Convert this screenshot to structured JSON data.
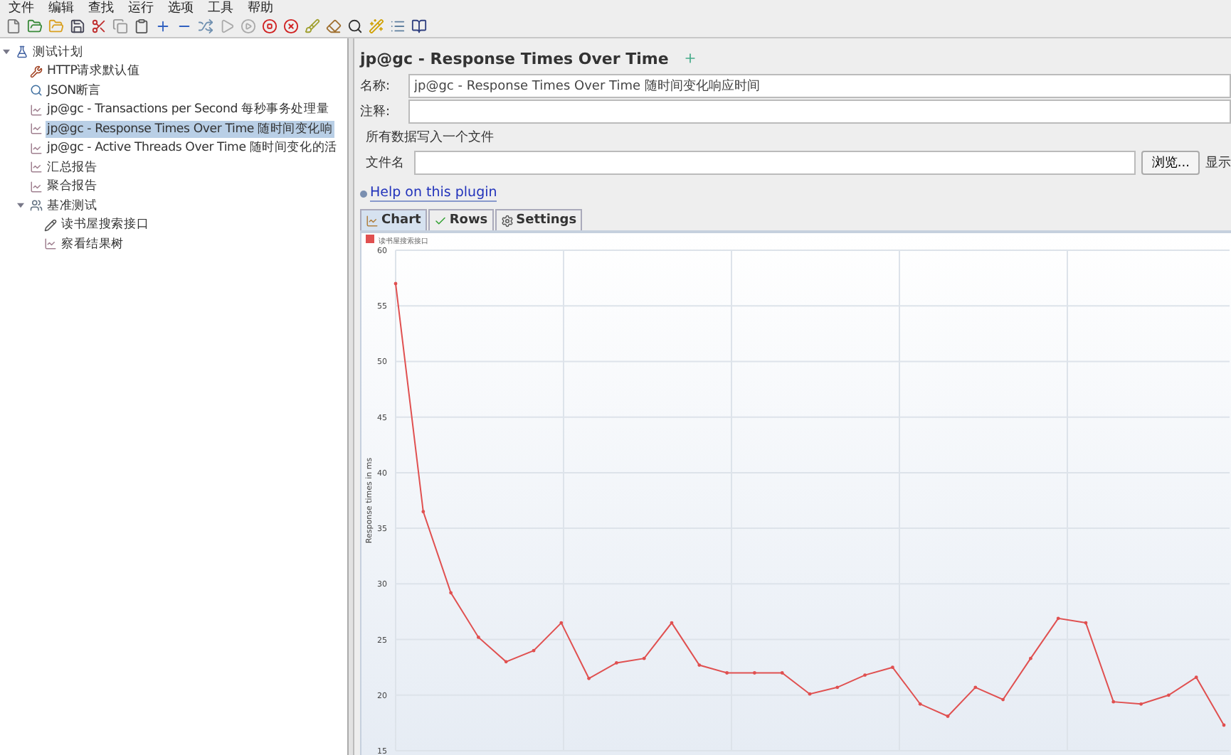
{
  "menu": [
    "文件",
    "编辑",
    "查找",
    "运行",
    "选项",
    "工具",
    "帮助"
  ],
  "tree": [
    {
      "label": "测试计划",
      "kind": "plan",
      "expanded": true,
      "selected": false,
      "children": [
        {
          "label": "HTTP请求默认值",
          "kind": "config",
          "selected": false
        },
        {
          "label": "JSON断言",
          "kind": "assertion",
          "selected": false
        },
        {
          "label": "jp@gc - Transactions per Second 每秒事务处理量",
          "kind": "listener",
          "selected": false
        },
        {
          "label": "jp@gc - Response Times Over Time 随时间变化响",
          "kind": "listener",
          "selected": true
        },
        {
          "label": "jp@gc - Active Threads Over Time 随时间变化的活",
          "kind": "listener",
          "selected": false
        },
        {
          "label": "汇总报告",
          "kind": "listener",
          "selected": false
        },
        {
          "label": "聚合报告",
          "kind": "listener",
          "selected": false
        },
        {
          "label": "基准测试",
          "kind": "threadgroup",
          "expanded": true,
          "selected": false,
          "children": [
            {
              "label": "读书屋搜索接口",
              "kind": "sampler",
              "selected": false
            },
            {
              "label": "察看结果树",
              "kind": "listener",
              "selected": false
            }
          ]
        }
      ]
    }
  ],
  "panel": {
    "title": "jp@gc - Response Times Over Time",
    "name_label": "名称:",
    "name_value": "jp@gc - Response Times Over Time 随时间变化响应时间",
    "comment_label": "注释:",
    "file_section": "所有数据写入一个文件",
    "file_label": "文件名",
    "browse_button": "浏览...",
    "display_label": "显示",
    "help_link": "Help on this plugin"
  },
  "tabs": [
    {
      "label": "Chart",
      "selected": true
    },
    {
      "label": "Rows",
      "selected": false
    },
    {
      "label": "Settings",
      "selected": false
    }
  ],
  "chart_data": {
    "type": "line",
    "grid": true,
    "ylabel": "Response times in ms",
    "ylim": [
      15,
      60
    ],
    "yticks": [
      15,
      20,
      25,
      30,
      35,
      40,
      45,
      50,
      55,
      60
    ],
    "series": [
      {
        "name": "读书屋搜索接口",
        "color": "#e05050",
        "values": [
          57.0,
          36.5,
          29.2,
          25.2,
          23.0,
          24.0,
          26.5,
          21.5,
          22.9,
          23.3,
          26.5,
          22.7,
          22.0,
          22.0,
          22.0,
          20.1,
          20.7,
          21.8,
          22.5,
          19.2,
          18.1,
          20.7,
          19.6,
          23.3,
          26.9,
          26.5,
          19.4,
          19.2,
          20.0,
          21.6,
          17.3
        ]
      }
    ]
  }
}
